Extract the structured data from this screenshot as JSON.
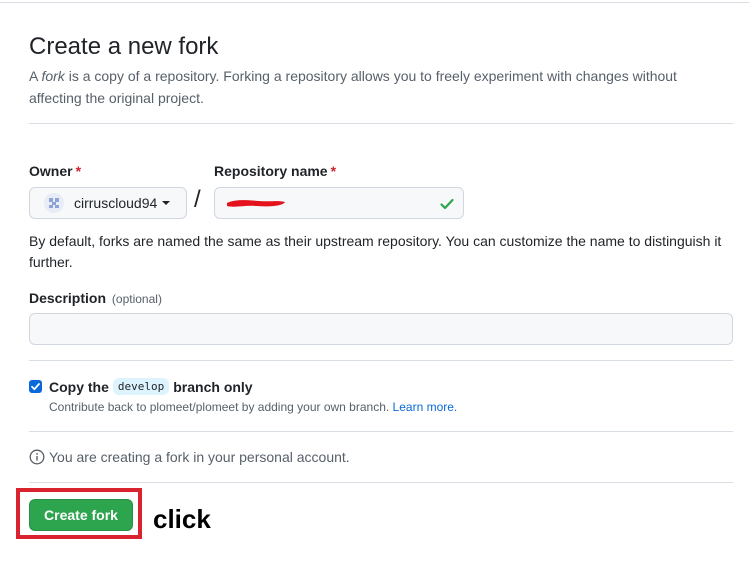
{
  "header": {
    "title": "Create a new fork",
    "subtitle_pre": "A ",
    "subtitle_em": "fork",
    "subtitle_post": " is a copy of a repository. Forking a repository allows you to freely experiment with changes without affecting the original project."
  },
  "owner": {
    "label": "Owner",
    "required_mark": "*",
    "value": "cirruscloud94"
  },
  "repository": {
    "label": "Repository name",
    "required_mark": "*",
    "separator": "/",
    "value_redacted": true,
    "valid_icon": "check-icon"
  },
  "hint": "By default, forks are named the same as their upstream repository. You can customize the name to distinguish it further.",
  "description": {
    "label": "Description",
    "optional_label": "(optional)",
    "value": "",
    "placeholder": ""
  },
  "copy_branch": {
    "checked": true,
    "label_pre": "Copy the",
    "branch": "develop",
    "label_post": "branch only",
    "note": "Contribute back to plomeet/plomeet by adding your own branch.",
    "learn_more": "Learn more."
  },
  "info": {
    "icon": "info-icon",
    "text": "You are creating a fork in your personal account."
  },
  "actions": {
    "create_label": "Create fork"
  },
  "annotation": {
    "text": "click"
  },
  "colors": {
    "primary_button": "#2da44e",
    "highlight_border": "#d9232f",
    "link": "#0969da",
    "required": "#cf222e"
  }
}
